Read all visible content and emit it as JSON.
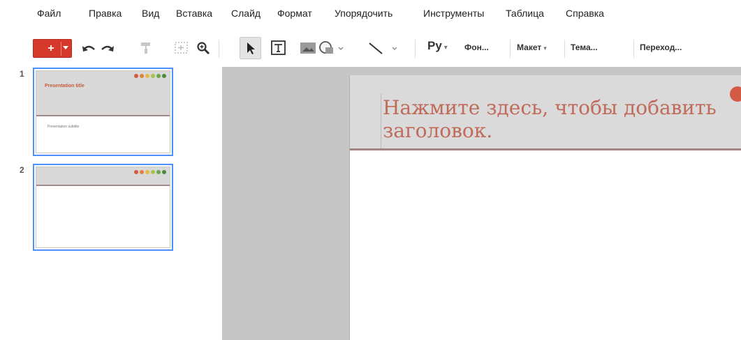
{
  "menu": [
    "Файл",
    "Правка",
    "Вид",
    "Вставка",
    "Слайд",
    "Формат",
    "Упорядочить",
    "Инструменты",
    "Таблица",
    "Справка"
  ],
  "toolbar": {
    "new_label": "+",
    "input_tools_label": "Ру",
    "background_label": "Фон...",
    "layout_label": "Макет",
    "theme_label": "Тема...",
    "transition_label": "Переход...",
    "caret": "▾"
  },
  "filmstrip": {
    "slides": [
      {
        "number": "1",
        "title": "Presentation title",
        "subtitle": "Presentation subtitle"
      },
      {
        "number": "2",
        "title": "",
        "subtitle": ""
      }
    ],
    "theme_dot_colors": [
      "#d35b45",
      "#e0823a",
      "#e8b84a",
      "#a7c24f",
      "#6aa64a",
      "#4c8a3e"
    ]
  },
  "slide": {
    "title_placeholder": "Нажмите здесь, чтобы добавить\nзаголовок."
  },
  "colors": {
    "accent_red": "#d6392b",
    "title_color": "#c06a5a",
    "selection_blue": "#4d90fe"
  }
}
